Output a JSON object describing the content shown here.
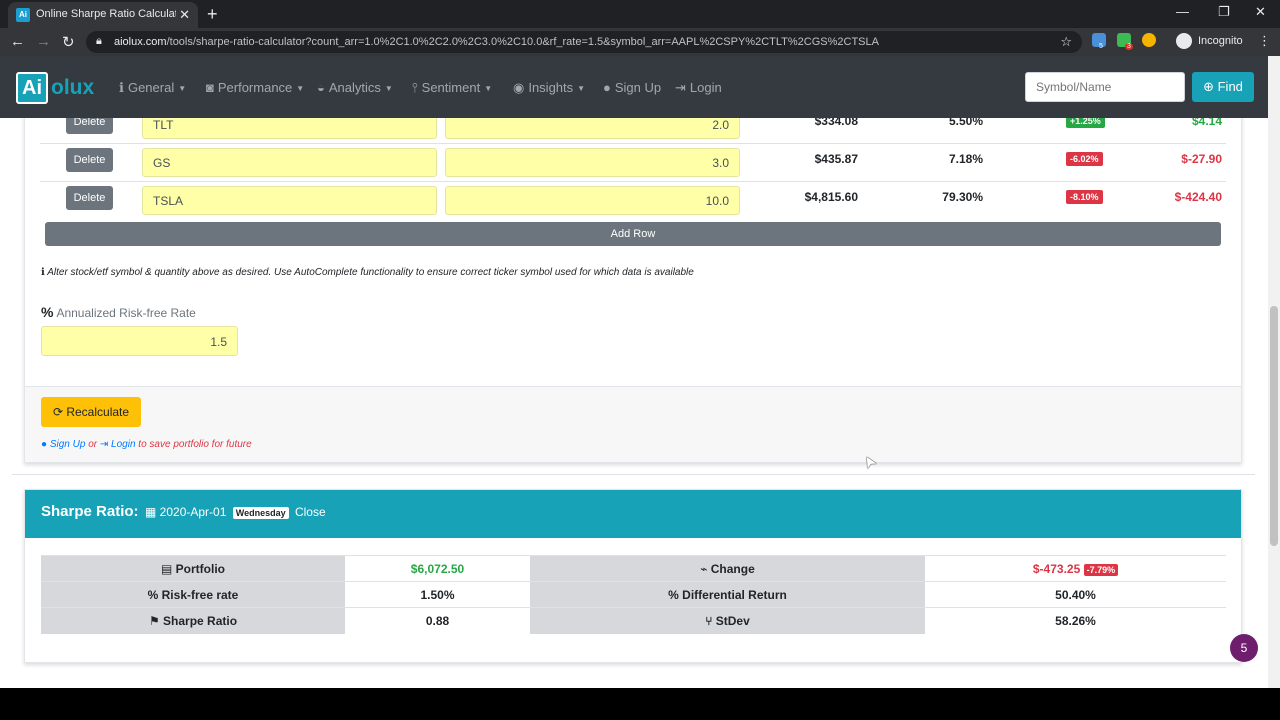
{
  "browser": {
    "tab_title": "Online Sharpe Ratio Calculator -",
    "new_tab": "+",
    "url_domain": "aiolux.com",
    "url_path": "/tools/sharpe-ratio-calculator?count_arr=1.0%2C1.0%2C2.0%2C3.0%2C10.0&rf_rate=1.5&symbol_arr=AAPL%2CSPY%2CTLT%2CGS%2CTSLA",
    "profile": "Incognito",
    "ext_badge_1": "5",
    "ext_badge_2": "3"
  },
  "navbar": {
    "logo_left": "Ai",
    "logo_right": "olux",
    "items": [
      {
        "label": "General",
        "icon": "info-circle-icon",
        "caret": true
      },
      {
        "label": "Performance",
        "icon": "camera-icon",
        "caret": true
      },
      {
        "label": "Analytics",
        "icon": "tachometer-icon",
        "caret": true
      },
      {
        "label": "Sentiment",
        "icon": "thermometer-icon",
        "caret": true
      },
      {
        "label": "Insights",
        "icon": "eye-icon",
        "caret": true
      },
      {
        "label": "Sign Up",
        "icon": "user-icon",
        "caret": false
      },
      {
        "label": "Login",
        "icon": "sign-in-icon",
        "caret": false
      }
    ],
    "search_placeholder": "Symbol/Name",
    "find_label": "Find"
  },
  "portfolio_rows": [
    {
      "delete": "Delete",
      "symbol": "TLT",
      "qty": "2.0",
      "value": "$334.08",
      "pct": "5.50%",
      "badge": "+1.25%",
      "badge_color": "#28a745",
      "change": "$4.14",
      "change_color": "#28a745"
    },
    {
      "delete": "Delete",
      "symbol": "GS",
      "qty": "3.0",
      "value": "$435.87",
      "pct": "7.18%",
      "badge": "-6.02%",
      "badge_color": "#dc3545",
      "change": "$-27.90",
      "change_color": "#dc3545"
    },
    {
      "delete": "Delete",
      "symbol": "TSLA",
      "qty": "10.0",
      "value": "$4,815.60",
      "pct": "79.30%",
      "badge": "-8.10%",
      "badge_color": "#dc3545",
      "change": "$-424.40",
      "change_color": "#dc3545"
    }
  ],
  "add_row": "Add Row",
  "note": "Alter stock/etf symbol & quantity above as desired. Use AutoComplete functionality to ensure correct ticker symbol used for which data is available",
  "risk_free": {
    "label": "Annualized Risk-free Rate",
    "value": "1.5"
  },
  "recalculate": "Recalculate",
  "save_note": {
    "signup": "Sign Up",
    "or": "or",
    "login": "Login",
    "rest": "to save portfolio for future"
  },
  "sharpe": {
    "title": "Sharpe Ratio:",
    "date": "2020-Apr-01",
    "weekday": "Wednesday",
    "close": "Close",
    "rows": [
      {
        "l1": "Portfolio",
        "v1": "$6,072.50",
        "l2": "Change",
        "v2": "$-473.25",
        "v2_badge": "-7.79%"
      },
      {
        "l1": "Risk-free rate",
        "v1": "1.50%",
        "l2": "Differential Return",
        "v2": "50.40%"
      },
      {
        "l1": "Sharpe Ratio",
        "v1": "0.88",
        "l2": "StDev",
        "v2": "58.26%"
      }
    ]
  },
  "chat_badge": "5",
  "colors": {
    "accent": "#17a2b8",
    "positive": "#28a745",
    "negative": "#dc3545",
    "warning": "#ffc107"
  }
}
